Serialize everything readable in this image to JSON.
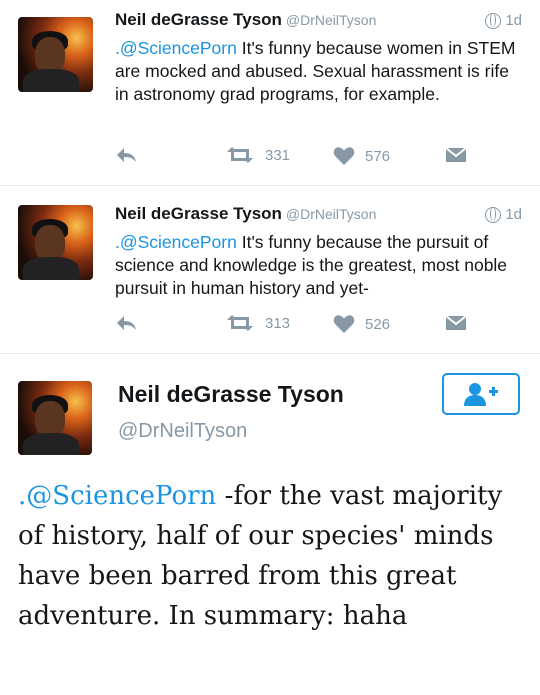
{
  "tweets": [
    {
      "name": "Neil deGrasse Tyson",
      "handle": "@DrNeilTyson",
      "time": "1d",
      "mention": ".@SciencePorn",
      "text": " It's funny because women in STEM are mocked and abused. Sexual harassment is rife in astronomy grad programs, for example.",
      "retweets": "331",
      "likes": "576"
    },
    {
      "name": "Neil deGrasse Tyson",
      "handle": "@DrNeilTyson",
      "time": "1d",
      "mention": ".@SciencePorn",
      "text": " It's funny because the pursuit of science and knowledge is the greatest, most noble pursuit in human history and yet-",
      "retweets": "313",
      "likes": "526"
    }
  ],
  "expanded": {
    "name": "Neil deGrasse Tyson",
    "handle": "@DrNeilTyson",
    "mention": ".@SciencePorn",
    "text": " -for the vast majority of history, half of our species' minds have been barred from this great adventure. In summary: haha",
    "follow_icon": "add-user-icon"
  },
  "colors": {
    "accent": "#1b95e0",
    "muted": "#8899a6",
    "text": "#14171a"
  }
}
